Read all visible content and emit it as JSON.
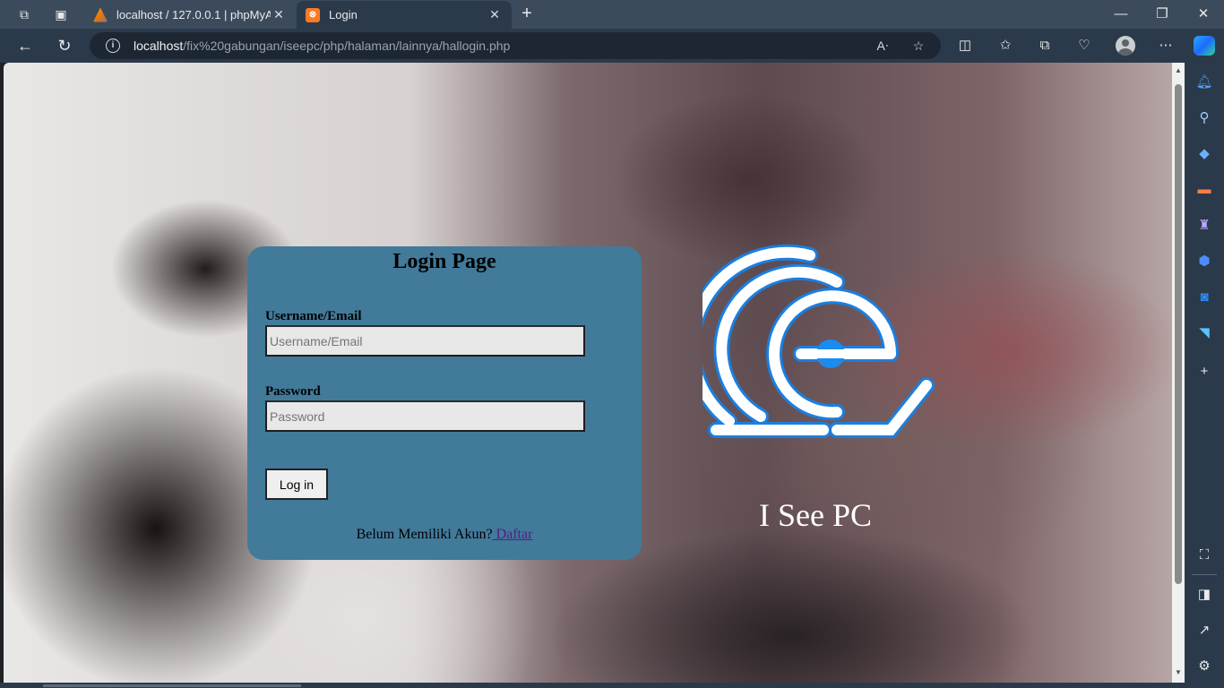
{
  "browser": {
    "tabs": [
      {
        "title": "localhost / 127.0.0.1 | phpMyAdmin",
        "active": false
      },
      {
        "title": "Login",
        "active": true
      }
    ],
    "address": {
      "host": "localhost",
      "path": "/fix%20gabungan/iseepc/php/halaman/lainnya/hallogin.php"
    }
  },
  "login": {
    "heading": "Login Page",
    "username_label": "Username/Email",
    "username_placeholder": "Username/Email",
    "username_value": "",
    "password_label": "Password",
    "password_placeholder": "Password",
    "password_value": "",
    "submit_label": "Log in",
    "signup_prompt": "Belum Memiliki Akun?",
    "signup_link": " Daftar"
  },
  "brand": {
    "name": "I See PC",
    "logo_color": "#1a7fe0"
  }
}
